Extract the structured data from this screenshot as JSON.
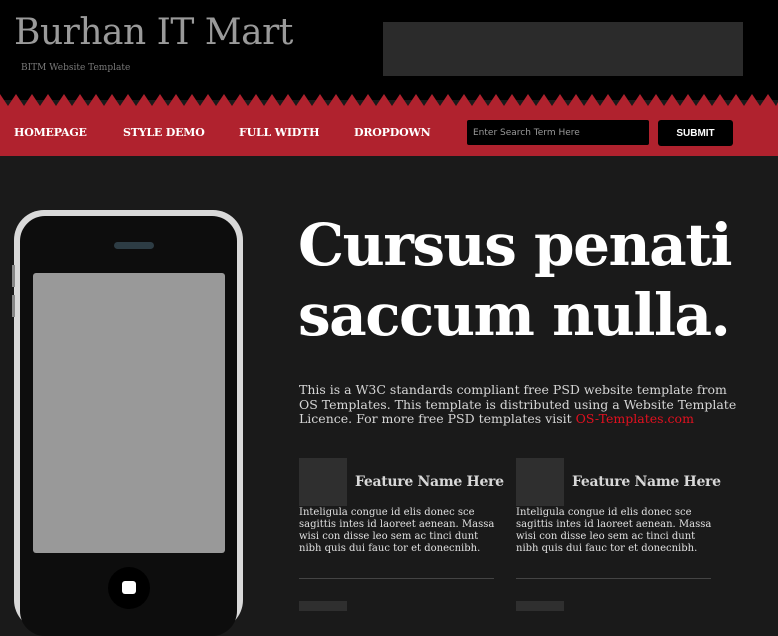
{
  "header": {
    "site_title": "Burhan IT Mart",
    "tagline": "BITM Website Template"
  },
  "nav": {
    "items": [
      {
        "label": "HOMEPAGE"
      },
      {
        "label": "STYLE DEMO"
      },
      {
        "label": "FULL WIDTH"
      },
      {
        "label": "DROPDOWN"
      }
    ],
    "search_placeholder": "Enter Search Term Here",
    "search_value": "",
    "submit_label": "SUBMIT"
  },
  "hero": {
    "title": "Cursus penati saccum nulla.",
    "text": "This is a W3C standards compliant free PSD website template from OS Templates. This template is distributed using a Website Template Licence. For more free PSD templates visit ",
    "link_text": "OS-Templates.com"
  },
  "features": [
    {
      "title": "Feature Name Here",
      "text": "Inteligula congue id elis donec sce sagittis intes id laoreet aenean. Massa wisi con disse leo sem ac tinci dunt nibh quis dui fauc tor et donecnibh."
    },
    {
      "title": "Feature Name Here",
      "text": "Inteligula congue id elis donec sce sagittis intes id laoreet aenean. Massa wisi con disse leo sem ac tinci dunt nibh quis dui fauc tor et donecnibh."
    }
  ],
  "colors": {
    "header_bg": "#000000",
    "nav_bg": "#b0222e",
    "body_bg": "#1a1a1a",
    "link": "#e2101f"
  }
}
